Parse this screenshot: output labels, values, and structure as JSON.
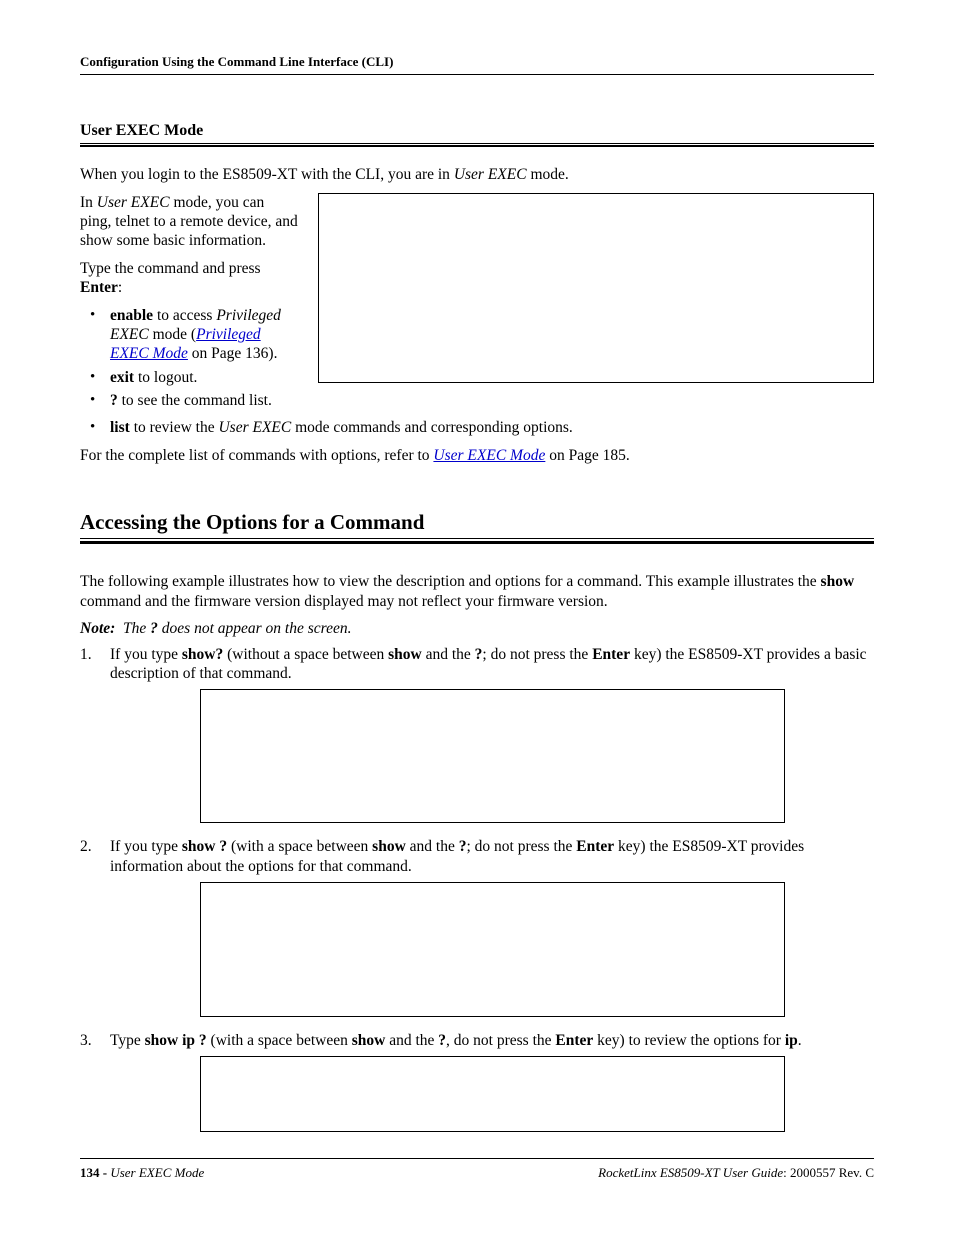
{
  "header": {
    "running": "Configuration Using the Command Line Interface (CLI)"
  },
  "sec1": {
    "title": "User EXEC Mode",
    "p_intro_a": "When you login to the ES8509-XT with the CLI, you are in ",
    "p_intro_b": "User EXEC",
    "p_intro_c": " mode.",
    "p2_a": "In ",
    "p2_b": "User EXEC",
    "p2_c": " mode, you can ping, telnet to a remote device, and show some basic information.",
    "p3_a": "Type the command and press ",
    "p3_b": "Enter",
    "p3_c": ":",
    "li1_a": "enable",
    "li1_b": " to access ",
    "li1_c": "Privileged EXEC",
    "li1_d": " mode (",
    "li1_link": "Privileged EXEC Mode",
    "li1_e": " on Page 136).",
    "li2_a": "exit",
    "li2_b": " to logout.",
    "li3_a": "?",
    "li3_b": " to see the command list.",
    "li4_a": "list",
    "li4_b": " to review the ",
    "li4_c": "User EXEC",
    "li4_d": " mode commands and corresponding options.",
    "p4_a": "For the complete list of commands with options, refer to ",
    "p4_link": "User EXEC Mode",
    "p4_b": " on Page 185."
  },
  "sec2": {
    "title": "Accessing the Options for a Command",
    "p1_a": "The following example illustrates how to view the description and options for a command. This example illustrates the ",
    "p1_b": "show",
    "p1_c": " command and the firmware version displayed may not reflect your firmware version.",
    "note_a": "Note:",
    "note_b": "The ",
    "note_c": "?",
    "note_d": " does not appear on the screen.",
    "li1_a": "If you type ",
    "li1_b": "show?",
    "li1_c": " (without a space between ",
    "li1_d": "show",
    "li1_e": " and the ",
    "li1_f": "?",
    "li1_g": "; do not press the ",
    "li1_h": "Enter",
    "li1_i": " key) the ES8509-XT provides a basic description of that command.",
    "li2_a": "If you type ",
    "li2_b": "show ?",
    "li2_c": " (with a space between ",
    "li2_d": "show",
    "li2_e": " and the ",
    "li2_f": "?",
    "li2_g": "; do not press the ",
    "li2_h": "Enter",
    "li2_i": " key) the ES8509-XT provides information about the options for that command.",
    "li3_a": "Type ",
    "li3_b": "show ip ?",
    "li3_c": " (with a space between ",
    "li3_d": "show",
    "li3_e": " and the ",
    "li3_f": "?",
    "li3_g": ", do not press the ",
    "li3_h": "Enter",
    "li3_i": " key) to review the options for ",
    "li3_j": "ip",
    "li3_k": "."
  },
  "footer": {
    "page": "134 - ",
    "left_title": "User EXEC Mode",
    "right_title": "RocketLinx ES8509-XT User Guide",
    "right_rev": ": 2000557 Rev. C"
  }
}
